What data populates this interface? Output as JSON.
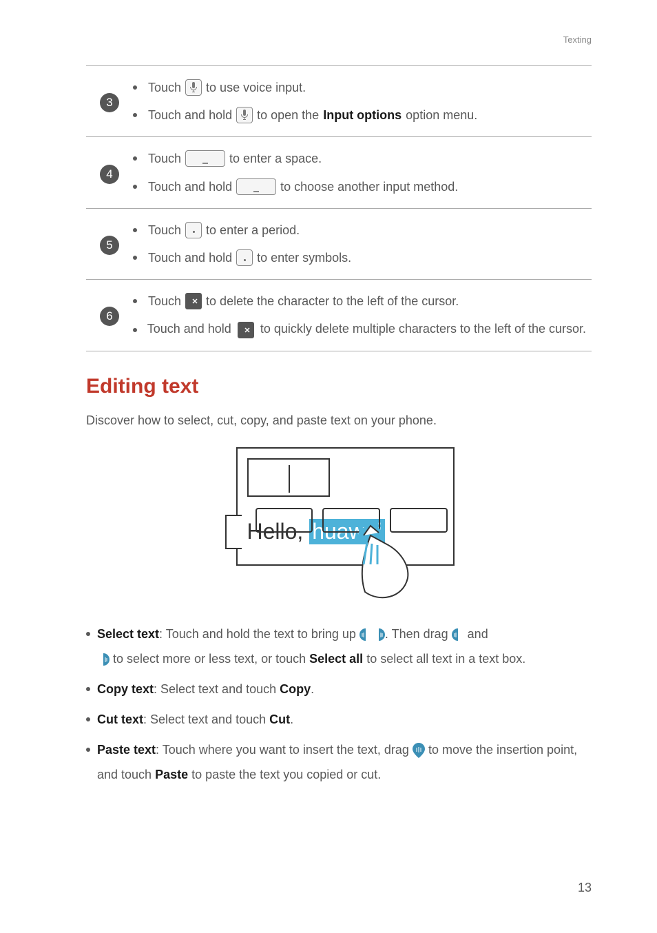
{
  "header": {
    "section": "Texting"
  },
  "table": {
    "rows": [
      {
        "num": "3",
        "lines": [
          {
            "pre": "Touch ",
            "icon": "mic",
            "post": " to use voice input."
          },
          {
            "pre": "Touch and hold ",
            "icon": "mic",
            "post1": " to open the ",
            "bold": "Input options",
            "post2": " option menu."
          }
        ]
      },
      {
        "num": "4",
        "lines": [
          {
            "pre": "Touch ",
            "icon": "space",
            "post": "to enter a space."
          },
          {
            "pre": "Touch and hold ",
            "icon": "space",
            "post": "to choose another input method."
          }
        ]
      },
      {
        "num": "5",
        "lines": [
          {
            "pre": "Touch ",
            "icon": "period",
            "post": " to enter a period."
          },
          {
            "pre": "Touch and hold ",
            "icon": "period",
            "post": " to enter symbols."
          }
        ]
      },
      {
        "num": "6",
        "lines": [
          {
            "pre": "Touch ",
            "icon": "backspace",
            "post": " to delete the character to the left of the cursor."
          },
          {
            "pre": "Touch and hold ",
            "icon": "backspace",
            "post": " to quickly delete multiple characters to the left of the cursor."
          }
        ]
      }
    ]
  },
  "heading": "Editing text",
  "intro": "Discover how to select, cut, copy, and paste text on your phone.",
  "figure": {
    "text_plain": "Hello,",
    "text_selected": "huawei"
  },
  "bullets": {
    "select": {
      "label": "Select text",
      "part1": ": Touch and hold the text to bring up ",
      "part2": ". Then drag ",
      "part3": " and",
      "cont1": " to select more or less text, or touch ",
      "bold": "Select all",
      "cont2": " to select all text in a text box."
    },
    "copy": {
      "label": "Copy text",
      "rest": ": Select text and touch ",
      "bold": "Copy",
      "end": "."
    },
    "cut": {
      "label": "Cut text",
      "rest": ": Select text and touch ",
      "bold": "Cut",
      "end": "."
    },
    "paste": {
      "label": "Paste text",
      "part1": ": Touch where you want to insert the text, drag ",
      "part2": " to move the insertion point, and touch ",
      "bold": "Paste",
      "part3": " to paste the text you copied or cut."
    }
  },
  "page": "13",
  "colors": {
    "accent": "#c1392b",
    "handle": "#3b8fb5",
    "highlight": "#4db2d9"
  }
}
